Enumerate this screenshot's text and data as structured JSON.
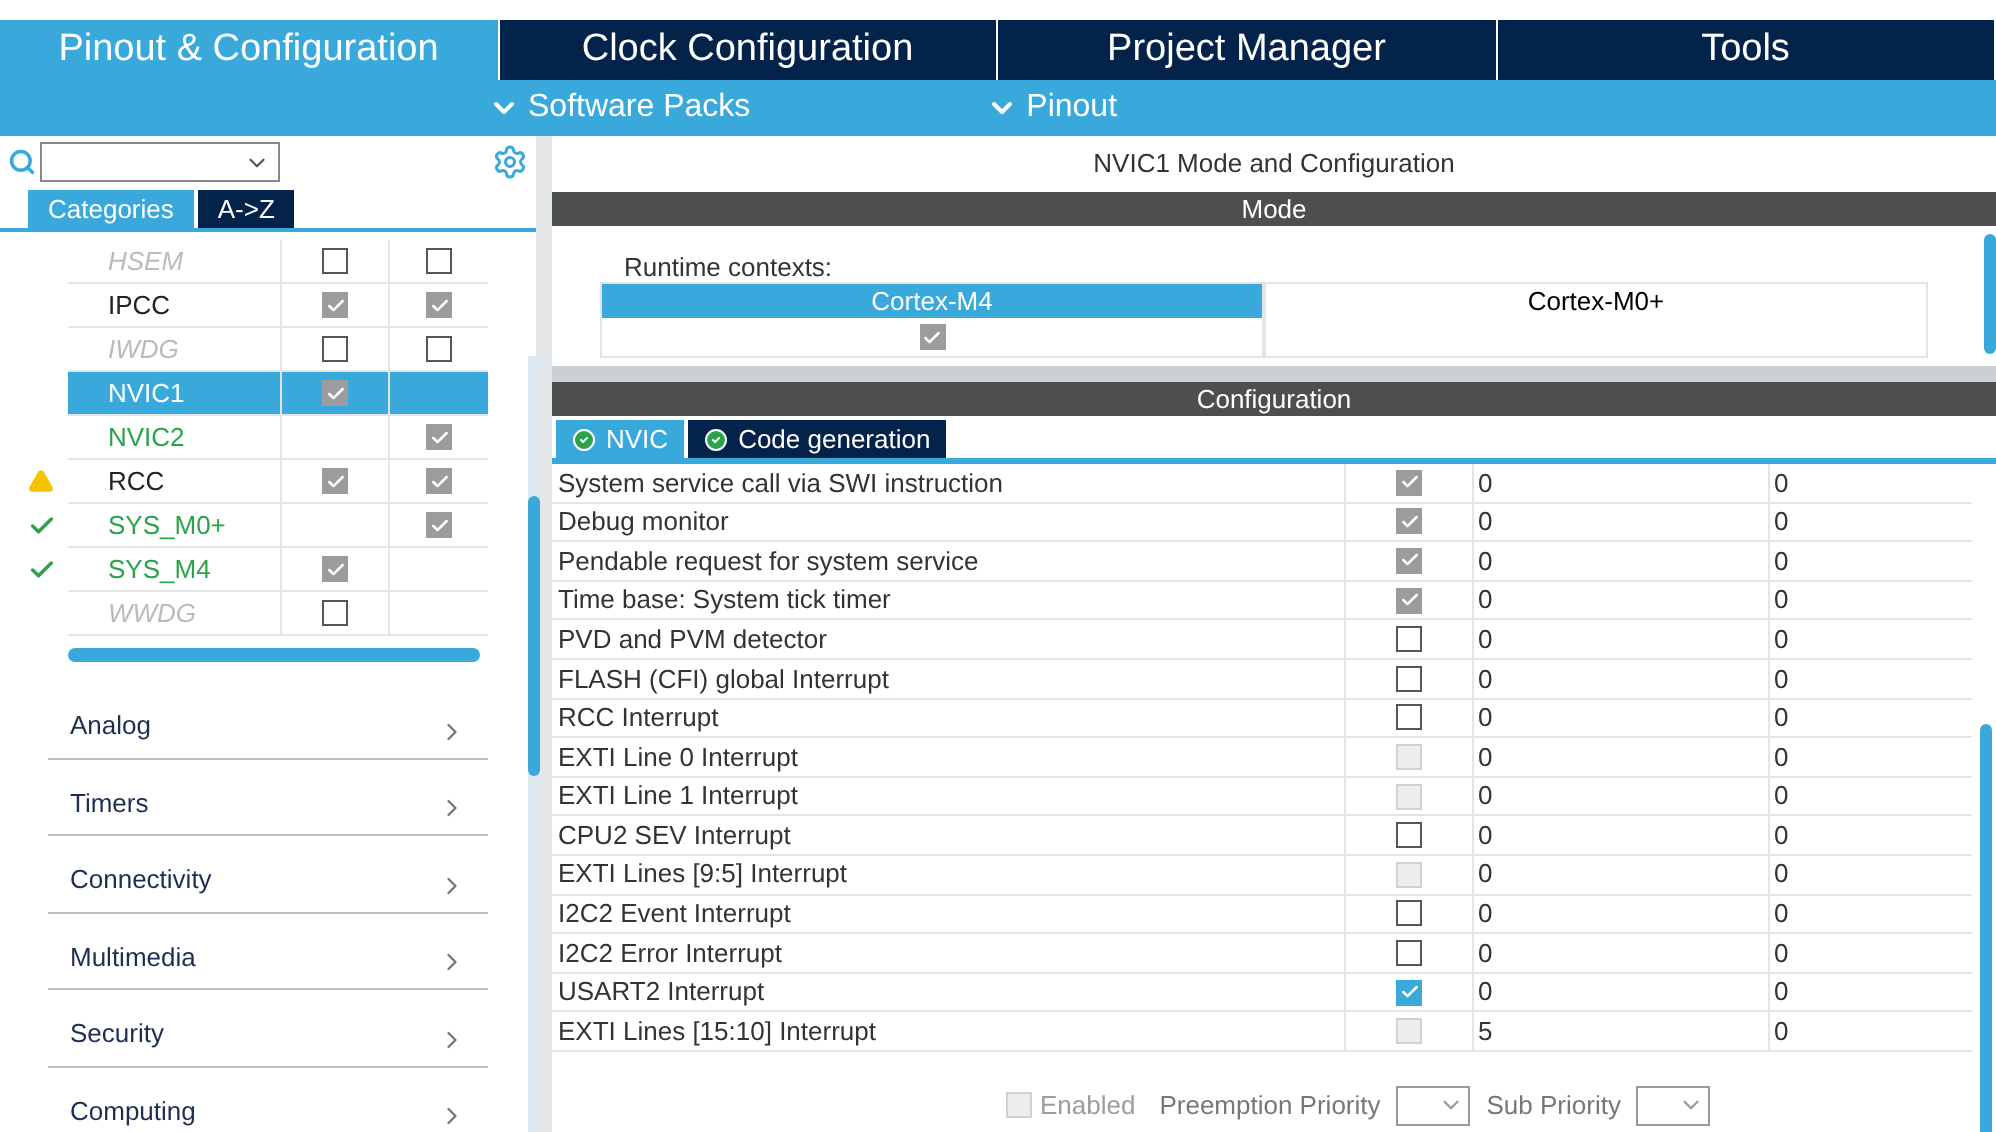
{
  "top_tabs": [
    {
      "label": "Pinout & Configuration",
      "selected": true
    },
    {
      "label": "Clock Configuration",
      "selected": false
    },
    {
      "label": "Project Manager",
      "selected": false
    },
    {
      "label": "Tools",
      "selected": false
    }
  ],
  "sub_menus": [
    {
      "label": "Software Packs"
    },
    {
      "label": "Pinout"
    }
  ],
  "sidebar": {
    "view_tabs": [
      {
        "label": "Categories",
        "selected": true
      },
      {
        "label": "A->Z",
        "selected": false
      }
    ],
    "peripherals": [
      {
        "name": "HSEM",
        "kind": "unavailable",
        "warning": false,
        "ok": false,
        "selected": false,
        "m4": false,
        "m0": false
      },
      {
        "name": "IPCC",
        "kind": "normal",
        "warning": false,
        "ok": false,
        "selected": false,
        "m4": true,
        "m0": true
      },
      {
        "name": "IWDG",
        "kind": "unavailable",
        "warning": false,
        "ok": false,
        "selected": false,
        "m4": false,
        "m0": false
      },
      {
        "name": "NVIC1",
        "kind": "normal",
        "warning": false,
        "ok": false,
        "selected": true,
        "m4": true
      },
      {
        "name": "NVIC2",
        "kind": "configured",
        "warning": false,
        "ok": false,
        "selected": false,
        "m0": true
      },
      {
        "name": "RCC",
        "kind": "normal",
        "warning": true,
        "ok": false,
        "selected": false,
        "m4": true,
        "m0": true
      },
      {
        "name": "SYS_M0+",
        "kind": "configured",
        "warning": false,
        "ok": true,
        "selected": false,
        "m0": true
      },
      {
        "name": "SYS_M4",
        "kind": "configured",
        "warning": false,
        "ok": true,
        "selected": false,
        "m4": true
      },
      {
        "name": "WWDG",
        "kind": "unavailable",
        "warning": false,
        "ok": false,
        "selected": false,
        "m4": false
      }
    ],
    "categories": [
      {
        "label": "Analog"
      },
      {
        "label": "Timers"
      },
      {
        "label": "Connectivity"
      },
      {
        "label": "Multimedia"
      },
      {
        "label": "Security"
      },
      {
        "label": "Computing"
      }
    ]
  },
  "panel": {
    "title": "NVIC1 Mode and Configuration",
    "mode_header": "Mode",
    "runtime_label": "Runtime contexts:",
    "contexts": [
      {
        "label": "Cortex-M4",
        "selected": true,
        "checked": true
      },
      {
        "label": "Cortex-M0+",
        "selected": false
      }
    ],
    "config_header": "Configuration",
    "config_tabs": [
      {
        "label": "NVIC",
        "selected": true
      },
      {
        "label": "Code generation",
        "selected": false
      }
    ],
    "interrupts": [
      {
        "name": "System service call via SWI instruction",
        "checked": true,
        "disabled": true,
        "preemption": "0",
        "sub": "0"
      },
      {
        "name": "Debug monitor",
        "checked": true,
        "disabled": true,
        "preemption": "0",
        "sub": "0"
      },
      {
        "name": "Pendable request for system service",
        "checked": true,
        "disabled": true,
        "preemption": "0",
        "sub": "0"
      },
      {
        "name": "Time base: System tick timer",
        "checked": true,
        "disabled": true,
        "preemption": "0",
        "sub": "0"
      },
      {
        "name": "PVD and PVM detector",
        "checked": false,
        "disabled": false,
        "preemption": "0",
        "sub": "0"
      },
      {
        "name": "FLASH (CFI)  global Interrupt",
        "checked": false,
        "disabled": false,
        "preemption": "0",
        "sub": "0"
      },
      {
        "name": "RCC Interrupt",
        "checked": false,
        "disabled": false,
        "preemption": "0",
        "sub": "0"
      },
      {
        "name": "EXTI Line 0 Interrupt",
        "checked": false,
        "disabled": true,
        "preemption": "0",
        "sub": "0"
      },
      {
        "name": "EXTI Line 1 Interrupt",
        "checked": false,
        "disabled": true,
        "preemption": "0",
        "sub": "0"
      },
      {
        "name": "CPU2 SEV Interrupt",
        "checked": false,
        "disabled": false,
        "preemption": "0",
        "sub": "0"
      },
      {
        "name": "EXTI Lines [9:5] Interrupt",
        "checked": false,
        "disabled": true,
        "preemption": "0",
        "sub": "0"
      },
      {
        "name": "I2C2 Event Interrupt",
        "checked": false,
        "disabled": false,
        "preemption": "0",
        "sub": "0"
      },
      {
        "name": "I2C2 Error Interrupt",
        "checked": false,
        "disabled": false,
        "preemption": "0",
        "sub": "0"
      },
      {
        "name": "USART2 Interrupt",
        "checked": true,
        "disabled": false,
        "preemption": "0",
        "sub": "0"
      },
      {
        "name": "EXTI Lines [15:10] Interrupt",
        "checked": false,
        "disabled": true,
        "preemption": "5",
        "sub": "0"
      }
    ],
    "footer": {
      "enabled_label": "Enabled",
      "enabled_checked": false,
      "preemption_label": "Preemption Priority",
      "sub_label": "Sub Priority"
    }
  }
}
